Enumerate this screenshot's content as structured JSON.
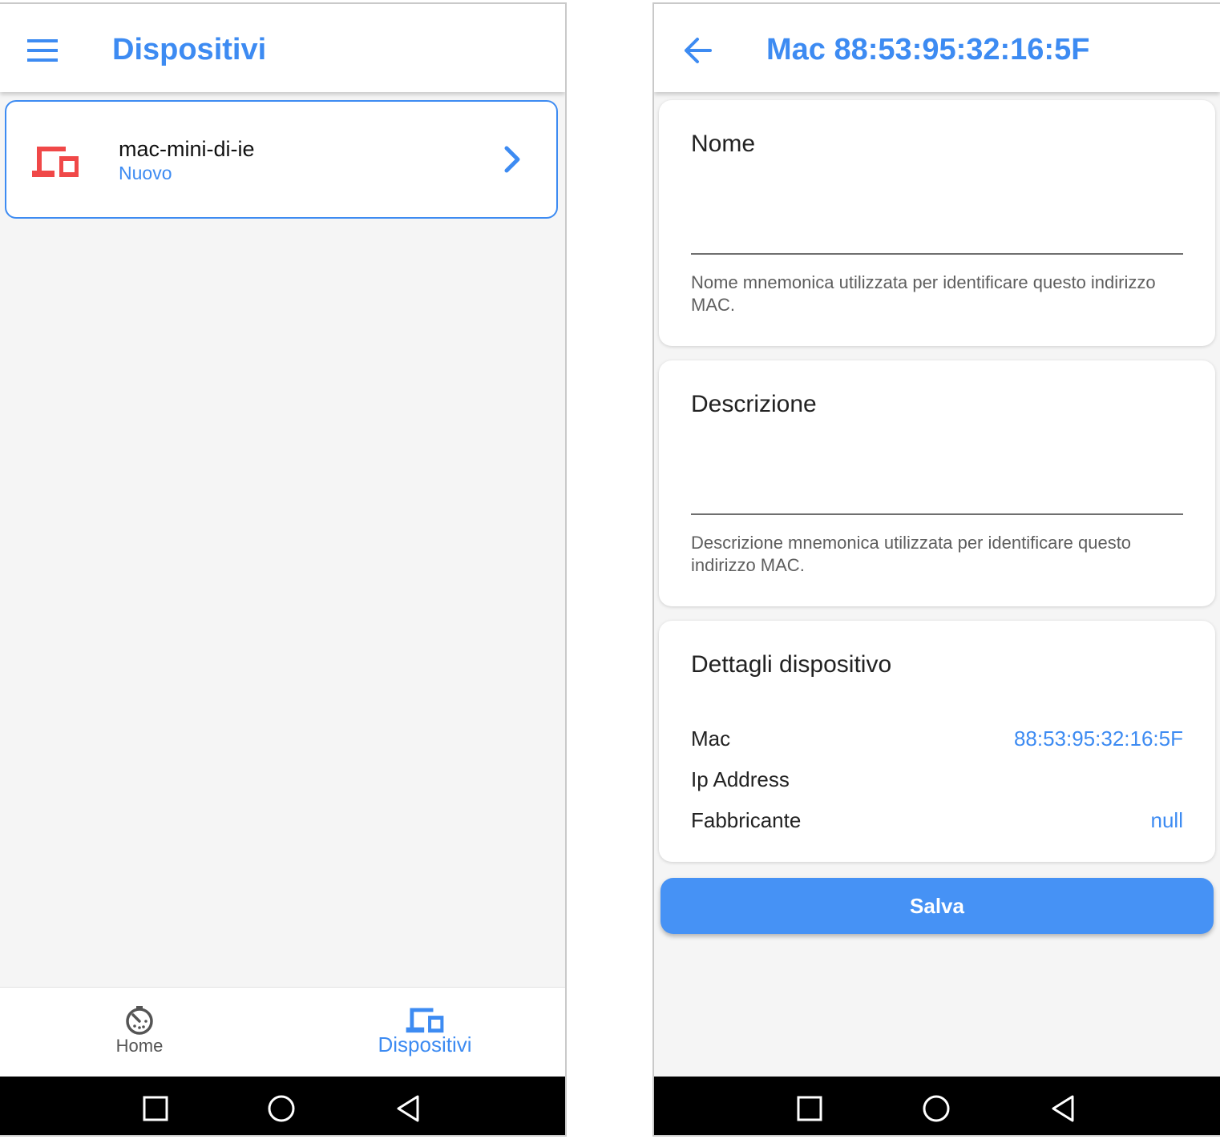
{
  "colors": {
    "accent": "#3d8bf2",
    "device_icon_new": "#f04848",
    "button_bg": "#4692f5",
    "nav_inactive": "#555555",
    "system_bar": "#000000"
  },
  "device_list_screen": {
    "app_bar": {
      "menu_icon": "hamburger-menu-icon",
      "title": "Dispositivi"
    },
    "devices": [
      {
        "icon": "devices-icon",
        "name": "mac-mini-di-ie",
        "status": "Nuovo",
        "action_icon": "chevron-right-icon"
      }
    ],
    "bottom_nav": {
      "items": [
        {
          "icon": "timer-icon",
          "label": "Home",
          "active": false
        },
        {
          "icon": "devices-icon",
          "label": "Dispositivi",
          "active": true
        }
      ]
    }
  },
  "device_detail_screen": {
    "app_bar": {
      "back_icon": "arrow-back-icon",
      "title": "Mac 88:53:95:32:16:5F"
    },
    "nome_card": {
      "title": "Nome",
      "value": "",
      "help": "Nome mnemonica utilizzata per identificare questo indirizzo MAC."
    },
    "descrizione_card": {
      "title": "Descrizione",
      "value": "",
      "help": "Descrizione mnemonica utilizzata per identificare questo indirizzo MAC."
    },
    "details_card": {
      "title": "Dettagli dispositivo",
      "rows": [
        {
          "label": "Mac",
          "value": "88:53:95:32:16:5F"
        },
        {
          "label": "Ip Address",
          "value": ""
        },
        {
          "label": "Fabbricante",
          "value": "null"
        }
      ]
    },
    "save_label": "Salva"
  },
  "system_nav": {
    "buttons": [
      "recent-apps-icon",
      "home-circle-icon",
      "back-triangle-icon"
    ]
  }
}
